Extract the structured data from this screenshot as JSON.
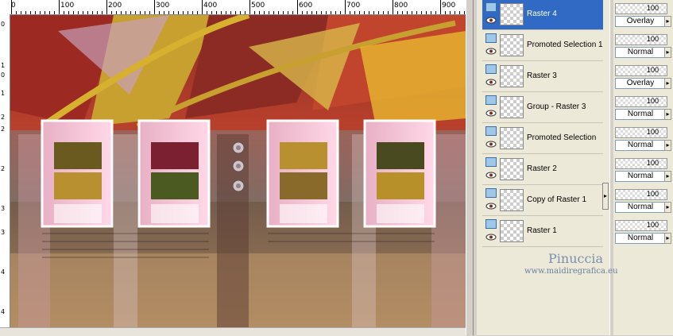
{
  "ruler": {
    "top_labels": [
      "0",
      "100",
      "200",
      "300",
      "400",
      "500",
      "600",
      "700",
      "800",
      "900"
    ],
    "left_labels": [
      "0",
      "1",
      "0",
      "1",
      "2",
      "2",
      "2",
      "3",
      "3",
      "4",
      "4"
    ]
  },
  "layers": [
    {
      "name": "Raster 4",
      "selected": true,
      "opacity": "100",
      "mode": "Overlay"
    },
    {
      "name": "Promoted Selection 1",
      "selected": false,
      "opacity": "100",
      "mode": "Normal"
    },
    {
      "name": "Raster 3",
      "selected": false,
      "opacity": "100",
      "mode": "Overlay"
    },
    {
      "name": "Group - Raster 3",
      "selected": false,
      "opacity": "100",
      "mode": "Normal"
    },
    {
      "name": "Promoted Selection",
      "selected": false,
      "opacity": "100",
      "mode": "Normal"
    },
    {
      "name": "Raster 2",
      "selected": false,
      "opacity": "100",
      "mode": "Normal"
    },
    {
      "name": "Copy of Raster 1",
      "selected": false,
      "opacity": "100",
      "mode": "Normal"
    },
    {
      "name": "Raster 1",
      "selected": false,
      "opacity": "100",
      "mode": "Normal"
    }
  ],
  "watermark": {
    "name": "Pinuccia",
    "url": "www.maidiregrafica.eu"
  },
  "icons": {
    "eye": "eye-icon",
    "layer": "raster-layer-icon",
    "dropdown": "dropdown-arrow-icon",
    "collapse": "collapse-arrow-icon"
  }
}
